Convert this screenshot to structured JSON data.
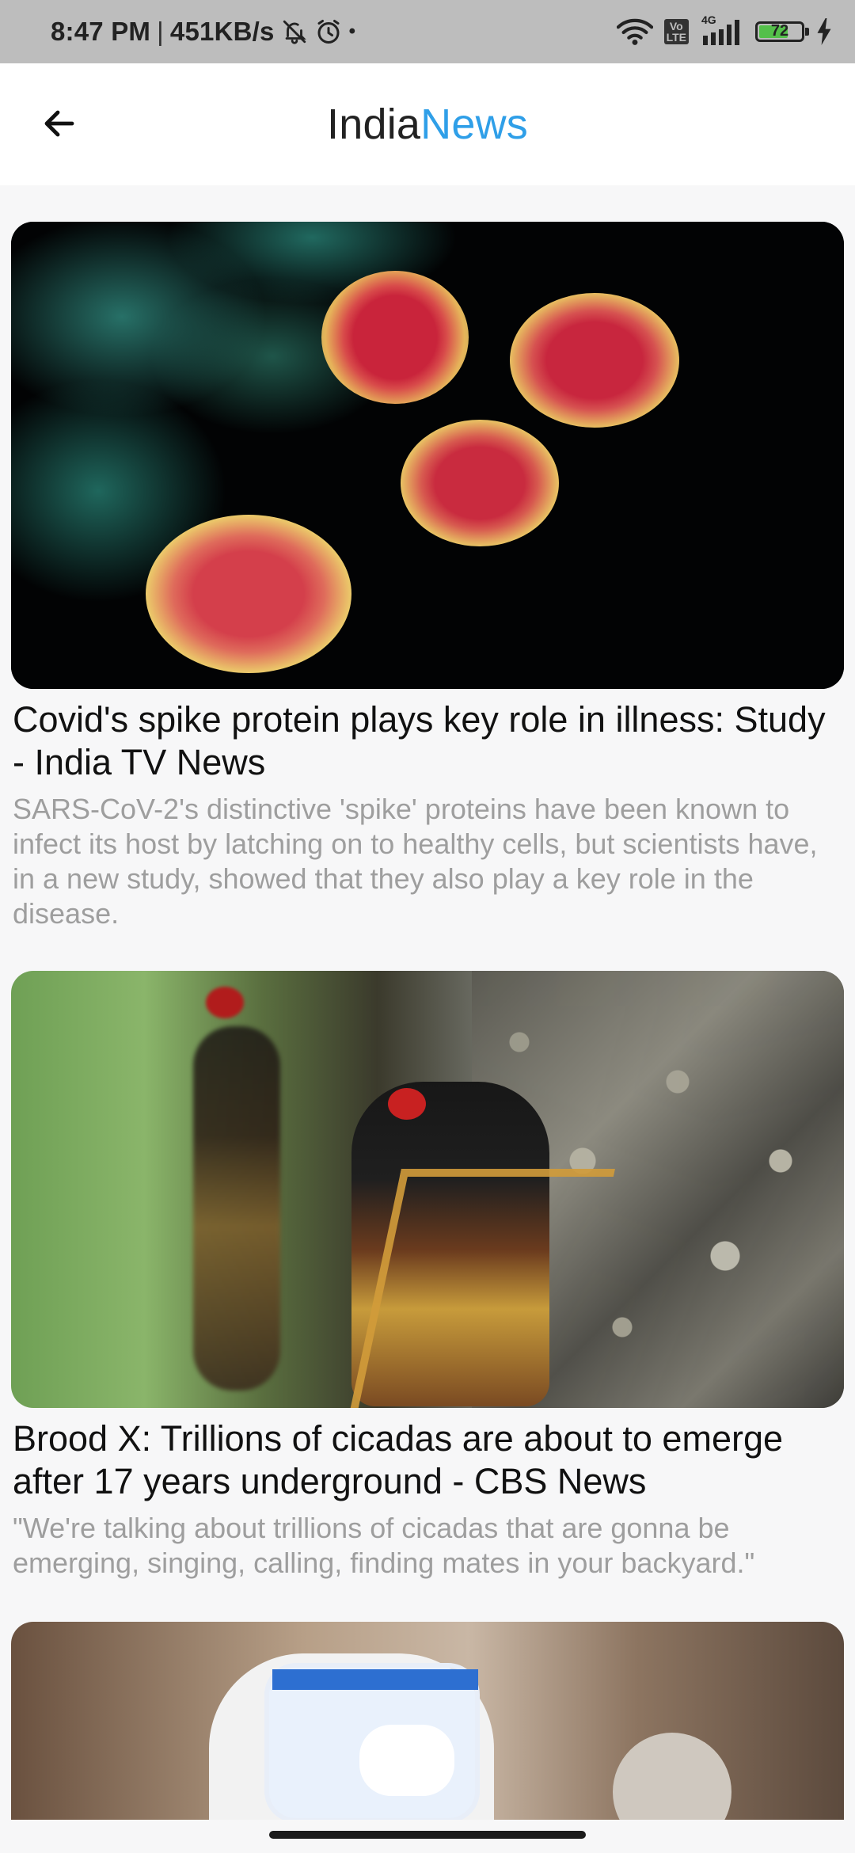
{
  "status_bar": {
    "time": "8:47 PM",
    "separator": "|",
    "network_speed": "451KB/s",
    "dot": "•",
    "volte_label": "Vo\nLTE",
    "network_label": "4G",
    "battery_level": "72",
    "battery_percent": 72,
    "icons": [
      "bell-off-icon",
      "alarm-icon",
      "wifi-icon",
      "volte-icon",
      "signal-icon",
      "battery-icon",
      "charging-icon"
    ]
  },
  "app_bar": {
    "title_part1": "India",
    "title_part2": "News",
    "title_colors": {
      "part1": "#222222",
      "part2": "#2f9fe8"
    },
    "back_icon": "arrow-left-icon"
  },
  "articles": [
    {
      "title": "Covid's spike protein plays key role in illness: Study - India TV News",
      "description": "SARS-CoV-2's distinctive 'spike' proteins have been known to infect its host by latching on to healthy cells, but scientists have, in a new study, showed that they also play a key role in the disease.",
      "image_subject": "coronavirus-particles"
    },
    {
      "title": "Brood X: Trillions of cicadas are about to emerge after 17 years underground - CBS News",
      "description": "\"We're talking about trillions of cicadas that are gonna be emerging, singing, calling, finding mates in your backyard.\"",
      "image_subject": "cicadas-on-tree"
    },
    {
      "title": "",
      "description": "",
      "image_subject": "health-worker-in-ppe"
    }
  ]
}
